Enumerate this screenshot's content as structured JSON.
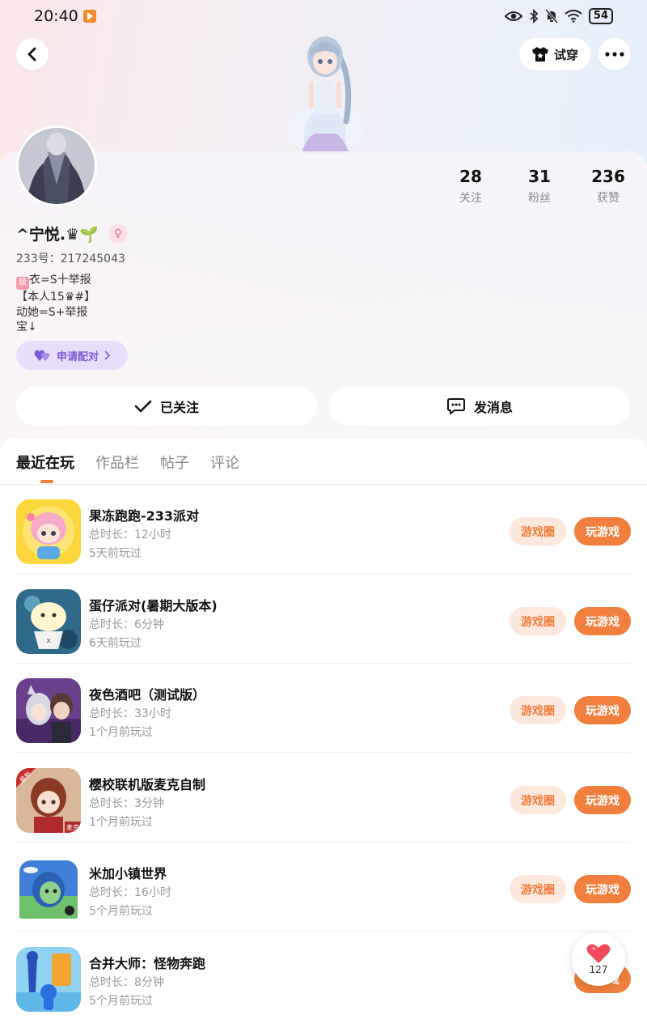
{
  "status_bar": {
    "time": "20:40",
    "battery": "54"
  },
  "header": {
    "try_on_label": "试穿"
  },
  "profile": {
    "stats": [
      {
        "value": "28",
        "label": "关注"
      },
      {
        "value": "31",
        "label": "粉丝"
      },
      {
        "value": "236",
        "label": "获赞"
      }
    ],
    "username": "^宁悦.♛🌱",
    "gender_symbol": "♀",
    "uid": "233号：217245043",
    "bio_tag": "禁",
    "bio_lines": [
      "衣=S十举报",
      "【本人15♛#】",
      "动她=S+举报",
      "宝↓"
    ],
    "match_label": "申请配对"
  },
  "actions": {
    "follow_label": "已关注",
    "message_label": "发消息"
  },
  "tabs": [
    "最近在玩",
    "作品栏",
    "帖子",
    "评论"
  ],
  "games": [
    {
      "name": "果冻跑跑-233派对",
      "duration": "总时长：12小时",
      "last_played": "5天前玩过",
      "circle_label": "游戏圈",
      "play_label": "玩游戏"
    },
    {
      "name": "蛋仔派对(暑期大版本)",
      "duration": "总时长：6分钟",
      "last_played": "6天前玩过",
      "circle_label": "游戏圈",
      "play_label": "玩游戏"
    },
    {
      "name": "夜色酒吧（测试版）",
      "duration": "总时长：33小时",
      "last_played": "1个月前玩过",
      "circle_label": "游戏圈",
      "play_label": "玩游戏"
    },
    {
      "name": "樱校联机版麦克自制",
      "duration": "总时长：3分钟",
      "last_played": "1个月前玩过",
      "circle_label": "游戏圈",
      "play_label": "玩游戏",
      "icon_badge_top": "最新",
      "icon_badge_bottom": "麦克"
    },
    {
      "name": "米加小镇世界",
      "duration": "总时长：16小时",
      "last_played": "5个月前玩过",
      "circle_label": "游戏圈",
      "play_label": "玩游戏"
    },
    {
      "name": "合并大师：怪物奔跑",
      "duration": "总时长：8分钟",
      "last_played": "5个月前玩过",
      "play_label": "玩游戏"
    }
  ],
  "like_fab": {
    "count": "127"
  }
}
